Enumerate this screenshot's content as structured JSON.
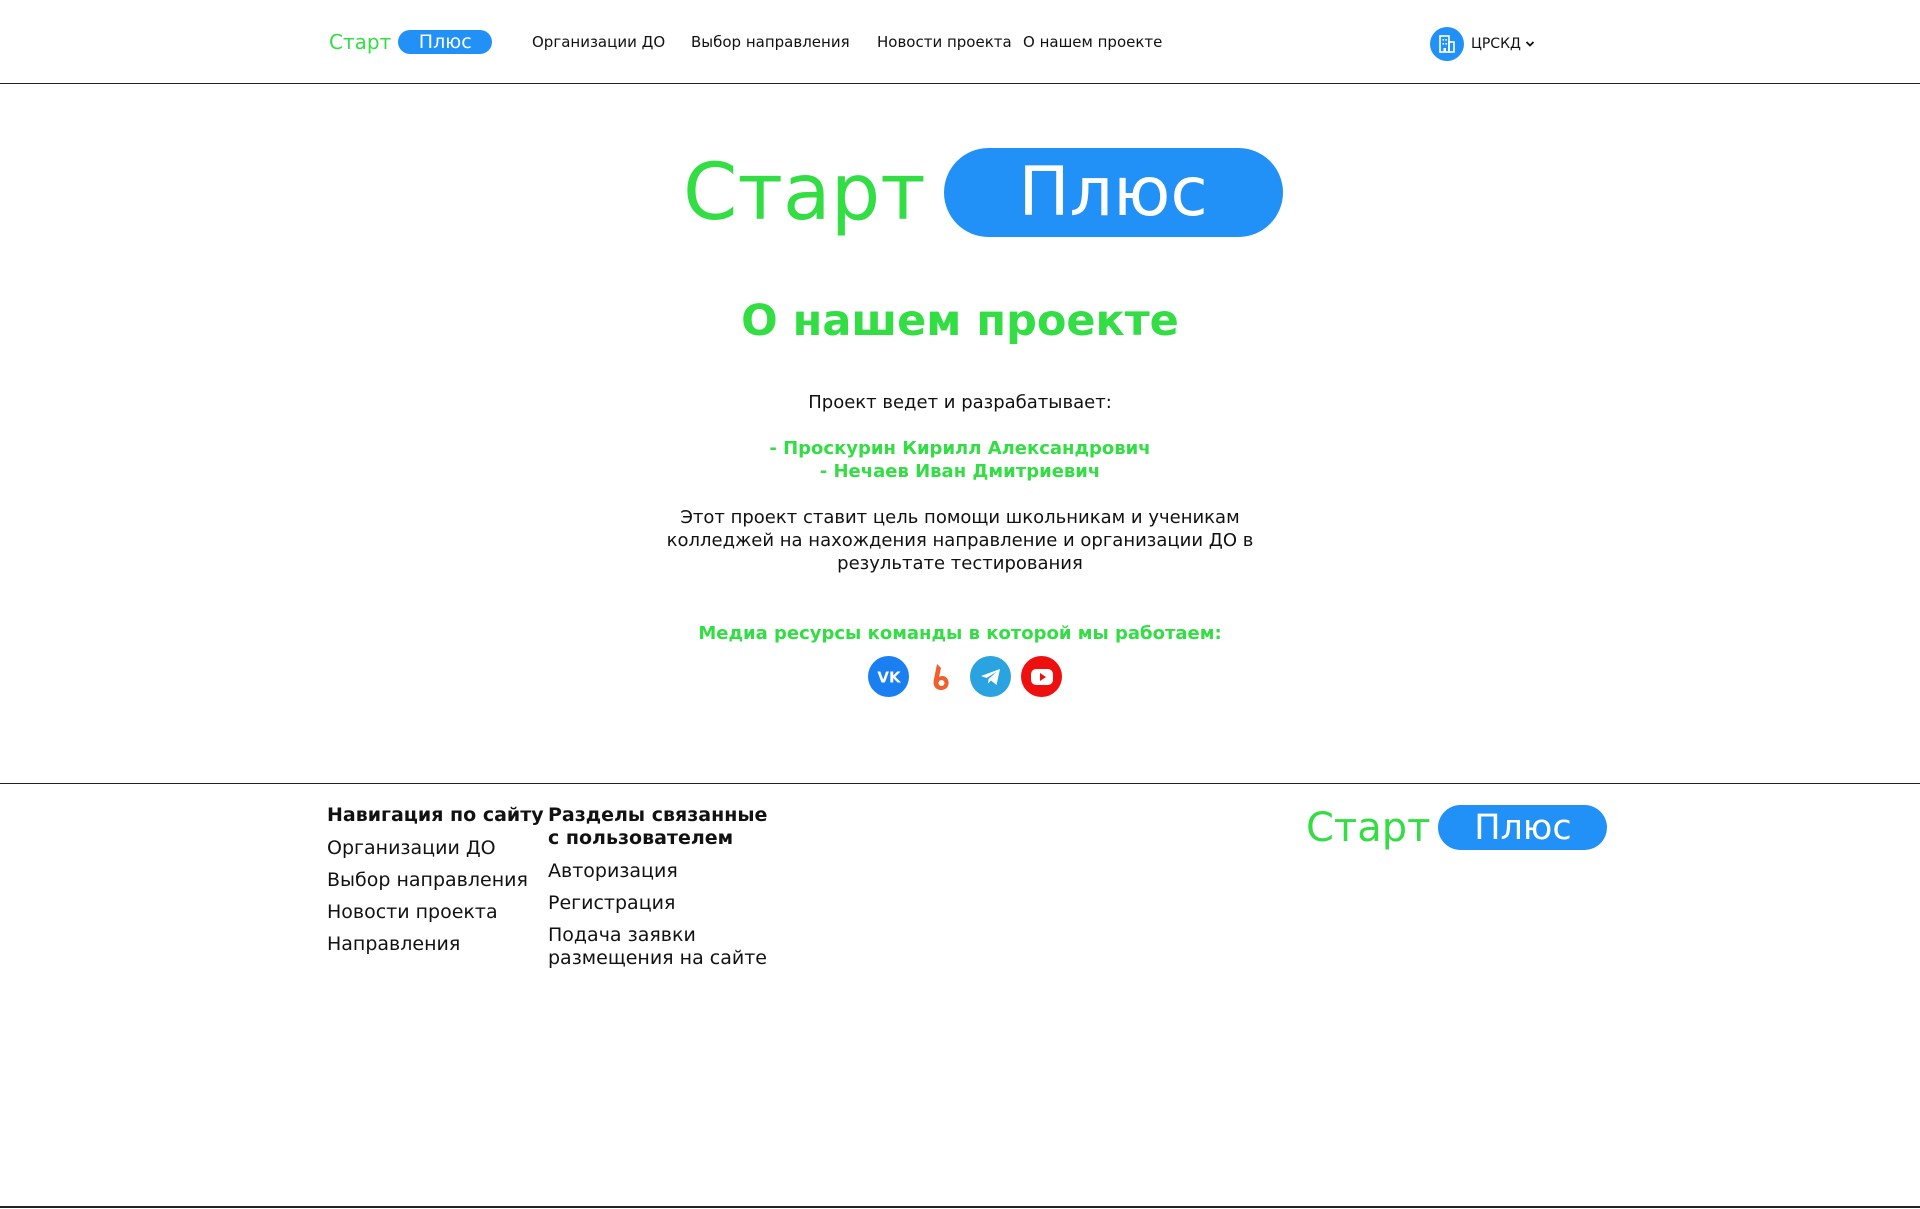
{
  "brand": {
    "word": "Старт",
    "pill": "Плюс"
  },
  "header": {
    "nav": [
      {
        "label": "Организации ДО"
      },
      {
        "label": "Выбор направления"
      },
      {
        "label": "Новости проекта"
      },
      {
        "label": "О нашем проекте"
      }
    ],
    "user": {
      "name": "ЦРСКД",
      "icon": "building-icon"
    }
  },
  "main": {
    "title": "О нашем проекте",
    "lead": "Проект ведет и разрабатывает:",
    "authors": [
      "- Проскурин Кирилл Александрович",
      "- Нечаев Иван Дмитриевич"
    ],
    "description": "Этот проект ставит цель помощи школьникам и ученикам колледжей на нахождения направление и организации ДО в результате тестирования",
    "media_title": "Медиа ресурсы команды в которой мы работаем:",
    "socials": [
      {
        "name": "vk",
        "icon": "vk-icon",
        "color": "#1a7ff0"
      },
      {
        "name": "boosty",
        "icon": "boosty-icon",
        "color": "#f15f2c"
      },
      {
        "name": "telegram",
        "icon": "telegram-icon",
        "color": "#2aa3e0"
      },
      {
        "name": "youtube",
        "icon": "youtube-icon",
        "color": "#ee0f0f"
      }
    ]
  },
  "footer": {
    "col1": {
      "heading": "Навигация по сайту",
      "links": [
        "Организации ДО",
        "Выбор направления",
        "Новости проекта",
        "Направления"
      ]
    },
    "col2": {
      "heading": "Разделы связанные с пользователем",
      "links": [
        "Авторизация",
        "Регистрация",
        "Подача заявки размещения на сайте"
      ]
    }
  },
  "colors": {
    "green": "#33dd44",
    "blue": "#2291f7"
  }
}
